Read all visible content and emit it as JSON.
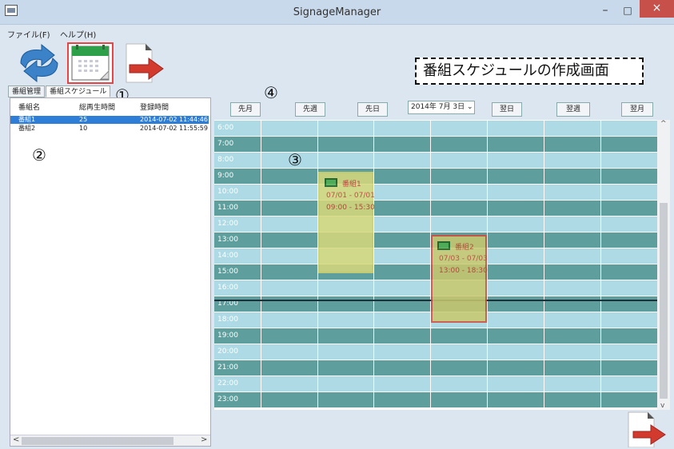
{
  "window": {
    "title": "SignageManager",
    "minimize": "–",
    "maximize": "□",
    "close": "×"
  },
  "menu": {
    "file": "ファイル(F)",
    "help": "ヘルプ(H)"
  },
  "callout": "番組スケジュールの作成画面",
  "markers": {
    "m1": "①",
    "m2": "②",
    "m3": "③",
    "m4": "④"
  },
  "tabs": [
    {
      "label": "番組管理"
    },
    {
      "label": "番組スケジュール"
    }
  ],
  "program_list": {
    "headers": [
      "番組名",
      "総再生時間",
      "登録時間"
    ],
    "rows": [
      {
        "name": "番組1",
        "duration": "25",
        "registered": "2014-07-02 11:44:46"
      },
      {
        "name": "番組2",
        "duration": "10",
        "registered": "2014-07-02 11:55:59"
      }
    ],
    "scroll_left": "<",
    "scroll_right": ">"
  },
  "nav": {
    "prev_month": "先月",
    "prev_week": "先週",
    "prev_day": "先日",
    "date": "2014年  7月  3日 ⌄",
    "next_day": "翌日",
    "next_week": "翌週",
    "next_month": "翌月"
  },
  "schedule": {
    "hours": [
      "6:00",
      "7:00",
      "8:00",
      "9:00",
      "10:00",
      "11:00",
      "12:00",
      "13:00",
      "14:00",
      "15:00",
      "16:00",
      "17:00",
      "18:00",
      "19:00",
      "20:00",
      "21:00",
      "22:00",
      "23:00"
    ],
    "blocks": [
      {
        "name": "番組1",
        "dates": "07/01 - 07/01",
        "times": "09:00 - 15:30",
        "border": "#d4d46a",
        "fill": "#d6d87a"
      },
      {
        "name": "番組2",
        "dates": "07/03 - 07/03",
        "times": "13:00 - 18:30",
        "border": "#d24a3e",
        "fill": "#c9c96e"
      }
    ]
  },
  "colors": {
    "light_row": "#aedae5",
    "dark_row": "#5e9e9c",
    "selected": "#2e7ed8",
    "close_btn": "#c7504a"
  },
  "icons": {
    "refresh": "refresh-arrows-icon",
    "schedule": "calendar-icon",
    "exit": "exit-arrow-icon"
  }
}
